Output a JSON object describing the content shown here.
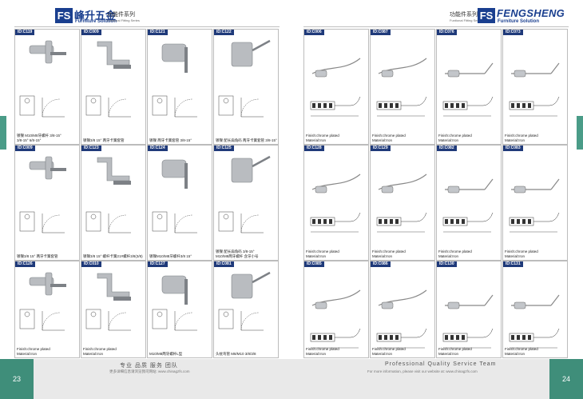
{
  "header_left": {
    "logo_text": "FS",
    "brand_cn": "峰升五金",
    "brand_en": "Furniture Solution",
    "series_cn": "功能件系列",
    "series_en": "Funtional Fitting Series"
  },
  "header_right": {
    "series_cn": "功能件系列",
    "series_en": "Funtional Fitting Series",
    "logo_text": "FS",
    "brand_big": "FENGSHENG",
    "brand_en": "Furniture Solution"
  },
  "left_cells": [
    {
      "id": "ID:C119",
      "caption": "镀镍 M10/M8牙螺杆 3/8-15°\n3/8-15° 6/8-15°"
    },
    {
      "id": "ID:C009",
      "caption": "镀镍3/8 15° 两牙卡簧套管"
    },
    {
      "id": "ID:C121",
      "caption": "镀镍 两牙卡簧套管 3/8-15°"
    },
    {
      "id": "ID:C122",
      "caption": "镀镍 配长扁角码 两牙卡簧套管 3/8-15°"
    },
    {
      "id": "ID:C009",
      "caption": "镀镍3/8 15° 两牙卡簧套管"
    },
    {
      "id": "ID:C123",
      "caption": "镀镍3/8 15° 螺杆卡簧21#螺杆3/8(3/8)"
    },
    {
      "id": "ID:C124",
      "caption": "镀镍M10/M8牙螺杆3/8 15°"
    },
    {
      "id": "ID:C125",
      "caption": "镀镍 配长扁角码 3/8-15°\nM10/M8两牙螺杆 含牙小号"
    },
    {
      "id": "ID:C126",
      "caption": "Finish:chrome plated\nMaterial:Iron"
    },
    {
      "id": "ID:C010",
      "caption": "Finish:chrome plated\nMaterial:Iron"
    },
    {
      "id": "ID:C127",
      "caption": "M10/M8两牙螺杆L型"
    },
    {
      "id": "ID:C081",
      "caption": "头枕弯管 M8/M10 3/8/3/8"
    }
  ],
  "right_cells": [
    {
      "id": "ID:C006",
      "caption": "Finish:chrome plated\nMaterial:Iron"
    },
    {
      "id": "ID:C087",
      "caption": "Finish:chrome plated\nMaterial:Iron"
    },
    {
      "id": "ID:C076",
      "caption": "Finish:chrome plated\nMaterial:Iron"
    },
    {
      "id": "ID:C073",
      "caption": "Finish:chrome plated\nMaterial:Iron"
    },
    {
      "id": "ID:C128",
      "caption": "Finish:chrome plated\nMaterial:Iron"
    },
    {
      "id": "ID:C129",
      "caption": "Finish:chrome plated\nMaterial:Iron"
    },
    {
      "id": "ID:C082",
      "caption": "Finish:chrome plated\nMaterial:Iron"
    },
    {
      "id": "ID:C083",
      "caption": "Finish:chrome plated\nMaterial:Iron"
    },
    {
      "id": "ID:C085",
      "caption": "Finish:chrome plated\nMaterial:Iron"
    },
    {
      "id": "ID:C086",
      "caption": "Finish:chrome plated\nMaterial:Iron"
    },
    {
      "id": "ID:C130",
      "caption": "Finish:chrome plated\nMaterial:Iron"
    },
    {
      "id": "ID:C131",
      "caption": "Finish:chrome plated\nMaterial:Iron"
    }
  ],
  "footer": {
    "page_left": "23",
    "page_right": "24",
    "slogan_cn": "专业 品质 服务 团队",
    "website_cn": "更多详细信息请浏览我司网站: www.chinagzfs.com",
    "slogan_en": "Professional  Quality  Service  Team",
    "website_en": "For more information, please visit our website at: www.chinagzfs.com"
  },
  "colors": {
    "brand_blue": "#1a3f8f",
    "accent_green": "#3f8e7a",
    "tag_bg": "#1f3a7a"
  }
}
